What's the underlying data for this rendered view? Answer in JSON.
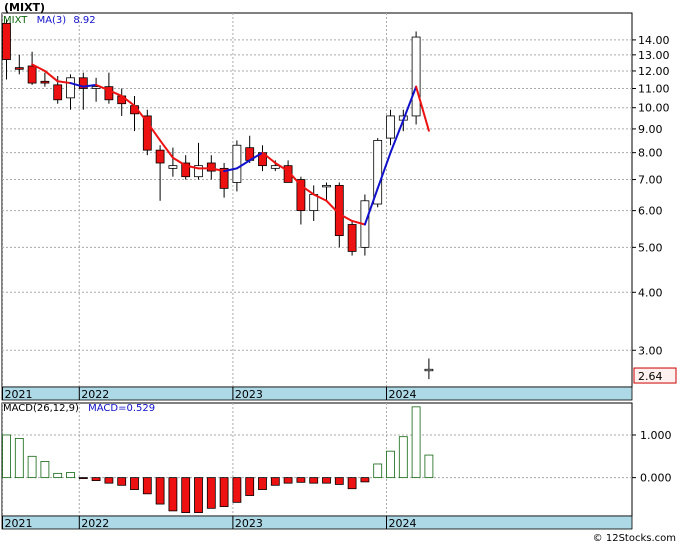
{
  "title": "(MIXT)",
  "footer": "© 12Stocks.com",
  "colors": {
    "up_body": "#ffffff",
    "up_edge": "#000000",
    "down_body": "#ee1111",
    "ma_down": "#ee1111",
    "ma_up": "#1111cc",
    "macd_green": "#116611",
    "band": "#add8e6",
    "grid": "#aaaaaa",
    "last_price_bg": "#fff0f0"
  },
  "chart_data": [
    {
      "type": "candlestick",
      "scale": "log",
      "ylim": [
        2.5,
        16
      ],
      "y_ticks": [
        3,
        4,
        5,
        6,
        7,
        8,
        9,
        10,
        11,
        12,
        13,
        14
      ],
      "y_tick_labels": [
        "3.00",
        "4.00",
        "5.00",
        "6.00",
        "7.00",
        "8.00",
        "9.00",
        "10.00",
        "11.00",
        "12.00",
        "13.00",
        "14.00"
      ],
      "x_labels": [
        "2021",
        "2022",
        "2023",
        "2024"
      ],
      "x_label_index": [
        0,
        6,
        18,
        30
      ],
      "legend": {
        "symbol": "MIXT",
        "ma_label": "MA(3)",
        "ma_value": "8.92"
      },
      "last_price": "2.64",
      "candles": [
        {
          "o": 15.2,
          "h": 15.5,
          "l": 11.5,
          "c": 12.7
        },
        {
          "o": 12.2,
          "h": 13.0,
          "l": 11.8,
          "c": 12.1
        },
        {
          "o": 12.3,
          "h": 13.2,
          "l": 11.2,
          "c": 11.3
        },
        {
          "o": 11.4,
          "h": 11.9,
          "l": 11.1,
          "c": 11.3
        },
        {
          "o": 11.2,
          "h": 11.7,
          "l": 10.2,
          "c": 10.4
        },
        {
          "o": 10.5,
          "h": 11.8,
          "l": 9.9,
          "c": 11.6
        },
        {
          "o": 11.6,
          "h": 11.9,
          "l": 9.9,
          "c": 11.0
        },
        {
          "o": 11.0,
          "h": 11.6,
          "l": 10.3,
          "c": 11.1
        },
        {
          "o": 11.1,
          "h": 11.9,
          "l": 10.2,
          "c": 10.4
        },
        {
          "o": 10.6,
          "h": 11.0,
          "l": 9.6,
          "c": 10.2
        },
        {
          "o": 10.1,
          "h": 10.6,
          "l": 8.9,
          "c": 9.7
        },
        {
          "o": 9.6,
          "h": 9.9,
          "l": 7.9,
          "c": 8.1
        },
        {
          "o": 8.1,
          "h": 8.3,
          "l": 6.3,
          "c": 7.6
        },
        {
          "o": 7.4,
          "h": 8.2,
          "l": 7.1,
          "c": 7.5
        },
        {
          "o": 7.6,
          "h": 7.9,
          "l": 7.0,
          "c": 7.1
        },
        {
          "o": 7.1,
          "h": 8.4,
          "l": 7.0,
          "c": 7.5
        },
        {
          "o": 7.6,
          "h": 7.9,
          "l": 7.0,
          "c": 7.3
        },
        {
          "o": 7.4,
          "h": 7.6,
          "l": 6.4,
          "c": 6.7
        },
        {
          "o": 6.9,
          "h": 8.5,
          "l": 6.6,
          "c": 8.3
        },
        {
          "o": 8.2,
          "h": 8.7,
          "l": 7.6,
          "c": 7.7
        },
        {
          "o": 8.0,
          "h": 8.3,
          "l": 7.3,
          "c": 7.5
        },
        {
          "o": 7.4,
          "h": 7.7,
          "l": 7.3,
          "c": 7.5
        },
        {
          "o": 7.5,
          "h": 7.7,
          "l": 6.9,
          "c": 6.9
        },
        {
          "o": 7.0,
          "h": 7.1,
          "l": 5.6,
          "c": 6.0
        },
        {
          "o": 6.0,
          "h": 6.8,
          "l": 5.7,
          "c": 6.5
        },
        {
          "o": 6.8,
          "h": 6.9,
          "l": 6.3,
          "c": 6.8
        },
        {
          "o": 6.8,
          "h": 6.9,
          "l": 5.0,
          "c": 5.3
        },
        {
          "o": 5.6,
          "h": 5.7,
          "l": 4.8,
          "c": 4.9
        },
        {
          "o": 5.0,
          "h": 6.5,
          "l": 4.8,
          "c": 6.3
        },
        {
          "o": 6.2,
          "h": 8.6,
          "l": 6.1,
          "c": 8.5
        },
        {
          "o": 8.6,
          "h": 9.9,
          "l": 8.3,
          "c": 9.6
        },
        {
          "o": 9.4,
          "h": 9.9,
          "l": 8.9,
          "c": 9.6
        },
        {
          "o": 9.6,
          "h": 14.6,
          "l": 9.2,
          "c": 14.2
        },
        {
          "o": 2.73,
          "h": 2.88,
          "l": 2.6,
          "c": 2.73
        }
      ],
      "ma": [
        null,
        null,
        12.4,
        12.0,
        11.4,
        11.3,
        11.1,
        11.2,
        10.9,
        10.6,
        10.1,
        9.3,
        8.5,
        7.8,
        7.5,
        7.4,
        7.4,
        7.3,
        7.4,
        7.7,
        8.0,
        7.6,
        7.3,
        6.8,
        6.5,
        6.3,
        5.9,
        5.7,
        5.6,
        6.7,
        8.0,
        9.4,
        11.1,
        8.92
      ],
      "ma_dir": [
        null,
        null,
        "down",
        "down",
        "down",
        "down",
        "up",
        "up",
        "down",
        "down",
        "down",
        "down",
        "down",
        "down",
        "down",
        "down",
        "down",
        "down",
        "up",
        "up",
        "up",
        "down",
        "down",
        "down",
        "down",
        "down",
        "down",
        "down",
        "down",
        "up",
        "up",
        "up",
        "up",
        "down"
      ]
    },
    {
      "type": "bar",
      "title": "MACD(26,12,9)",
      "legend": {
        "label": "MACD(26,12,9)",
        "value_label": "MACD=0.529"
      },
      "ylim": [
        -0.9,
        1.75
      ],
      "y_ticks": [
        0,
        1
      ],
      "y_tick_labels": [
        "0.000",
        "1.000"
      ],
      "x_labels": [
        "2021",
        "2022",
        "2023",
        "2024"
      ],
      "values": [
        1.0,
        0.92,
        0.5,
        0.38,
        0.1,
        0.12,
        -0.02,
        -0.07,
        -0.13,
        -0.18,
        -0.28,
        -0.38,
        -0.62,
        -0.78,
        -0.82,
        -0.82,
        -0.72,
        -0.68,
        -0.58,
        -0.42,
        -0.28,
        -0.18,
        -0.13,
        -0.11,
        -0.13,
        -0.13,
        -0.16,
        -0.26,
        -0.1,
        0.32,
        0.62,
        0.96,
        1.66,
        0.529
      ]
    }
  ]
}
